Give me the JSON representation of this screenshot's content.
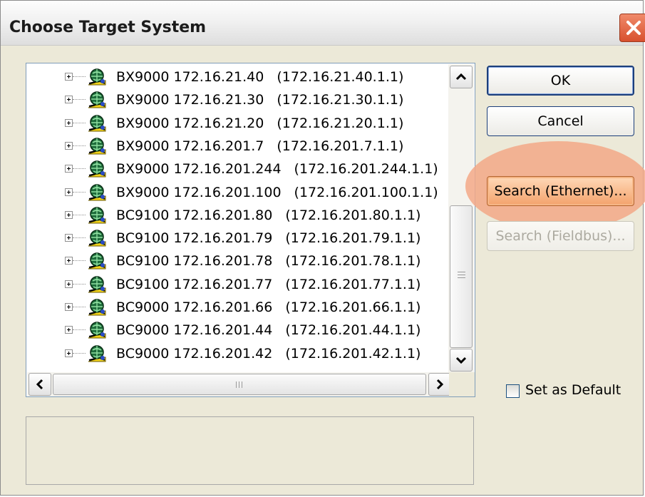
{
  "window": {
    "title": "Choose Target System"
  },
  "tree": {
    "items": [
      {
        "label": "BX9000 172.16.21.40",
        "address": "(172.16.21.40.1.1)"
      },
      {
        "label": "BX9000 172.16.21.30",
        "address": "(172.16.21.30.1.1)"
      },
      {
        "label": "BX9000 172.16.21.20",
        "address": "(172.16.21.20.1.1)"
      },
      {
        "label": "BX9000 172.16.201.7",
        "address": "(172.16.201.7.1.1)"
      },
      {
        "label": "BX9000 172.16.201.244",
        "address": "(172.16.201.244.1.1)"
      },
      {
        "label": "BX9000 172.16.201.100",
        "address": "(172.16.201.100.1.1)"
      },
      {
        "label": "BC9100 172.16.201.80",
        "address": "(172.16.201.80.1.1)"
      },
      {
        "label": "BC9100 172.16.201.79",
        "address": "(172.16.201.79.1.1)"
      },
      {
        "label": "BC9100 172.16.201.78",
        "address": "(172.16.201.78.1.1)"
      },
      {
        "label": "BC9100 172.16.201.77",
        "address": "(172.16.201.77.1.1)"
      },
      {
        "label": "BC9000 172.16.201.66",
        "address": "(172.16.201.66.1.1)"
      },
      {
        "label": "BC9000 172.16.201.44",
        "address": "(172.16.201.44.1.1)"
      },
      {
        "label": "BC9000 172.16.201.42",
        "address": "(172.16.201.42.1.1)"
      }
    ]
  },
  "buttons": {
    "ok": "OK",
    "cancel": "Cancel",
    "search_ethernet": "Search (Ethernet)...",
    "search_fieldbus": "Search (Fieldbus)..."
  },
  "checkbox": {
    "label": "Set as Default",
    "checked": false
  },
  "colors": {
    "highlight": "#f3a887",
    "window_bg": "#ece9d8",
    "button_border": "#1d3f7a"
  },
  "icons": {
    "close": "close-icon",
    "node": "network-node-icon",
    "expand": "plus-expander-icon",
    "scroll_up": "chevron-up-icon",
    "scroll_down": "chevron-down-icon",
    "scroll_left": "chevron-left-icon",
    "scroll_right": "chevron-right-icon"
  }
}
